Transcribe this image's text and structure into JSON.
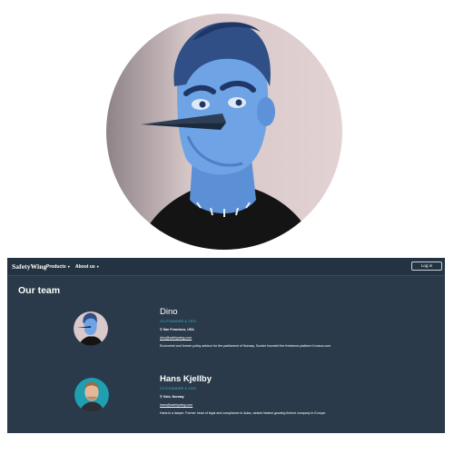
{
  "hero": {
    "image": "cartoon-blue-bird-face-portrait"
  },
  "site": {
    "logo": "SafetyWing",
    "nav": {
      "products_label": "Products",
      "about_label": "About us",
      "login_label": "Log in"
    },
    "section_title": "Our team",
    "members": [
      {
        "name": "Dino",
        "role": "CO-FOUNDER & CEO",
        "location": "San Francisco, USA",
        "email": "dino@safetywing.com",
        "bio": "Economist and former policy advisor for the parliament of Norway. Sondre founded the freelance-platform Konsus.com."
      },
      {
        "name": "Hans Kjellby",
        "role": "CO-FOUNDER & COO",
        "location": "Oslo, Norway",
        "email": "hans@safetywing.com",
        "bio": "Hans is a lawyer. Former head of legal and compliance in Auka, ranked fastest growing fintech company in Europe."
      }
    ],
    "colors": {
      "background": "#2a3a4a",
      "accent": "#3fc1c9"
    }
  }
}
